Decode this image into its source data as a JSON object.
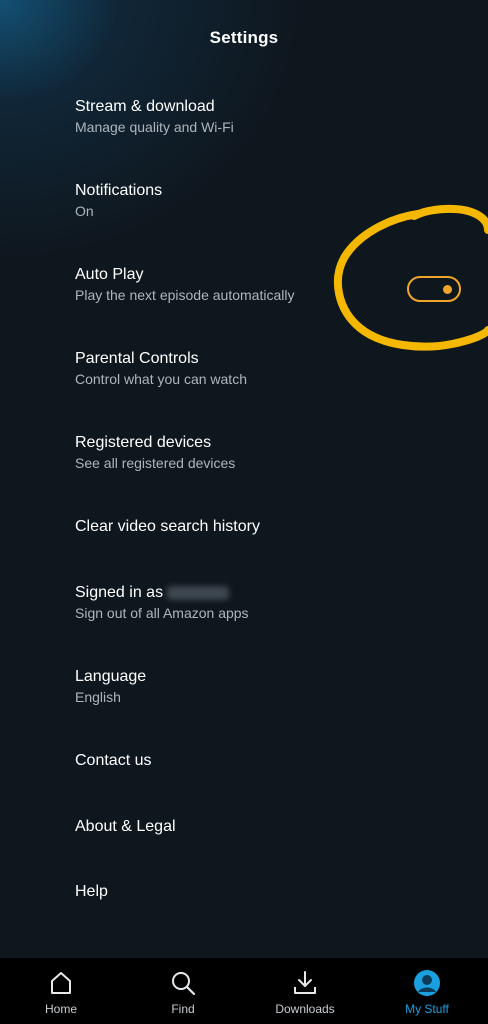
{
  "header": {
    "title": "Settings"
  },
  "settings": [
    {
      "label": "Stream & download",
      "sub": "Manage quality and Wi-Fi"
    },
    {
      "label": "Notifications",
      "sub": "On"
    },
    {
      "label": "Auto Play",
      "sub": "Play the next episode automatically"
    },
    {
      "label": "Parental Controls",
      "sub": "Control what you can watch"
    },
    {
      "label": "Registered devices",
      "sub": "See all registered devices"
    },
    {
      "label": "Clear video search history"
    },
    {
      "label": "Signed in as",
      "sub": "Sign out of all Amazon apps"
    },
    {
      "label": "Language",
      "sub": "English"
    },
    {
      "label": "Contact us"
    },
    {
      "label": "About & Legal"
    },
    {
      "label": "Help"
    }
  ],
  "autoplay_toggle": {
    "state": "on",
    "color": "#f0a52a"
  },
  "annotation": {
    "color": "#f5b800"
  },
  "nav": {
    "items": [
      {
        "label": "Home",
        "icon": "home-icon"
      },
      {
        "label": "Find",
        "icon": "search-icon"
      },
      {
        "label": "Downloads",
        "icon": "download-icon"
      },
      {
        "label": "My Stuff",
        "icon": "avatar-icon"
      }
    ],
    "active_color": "#1aa0e0"
  }
}
